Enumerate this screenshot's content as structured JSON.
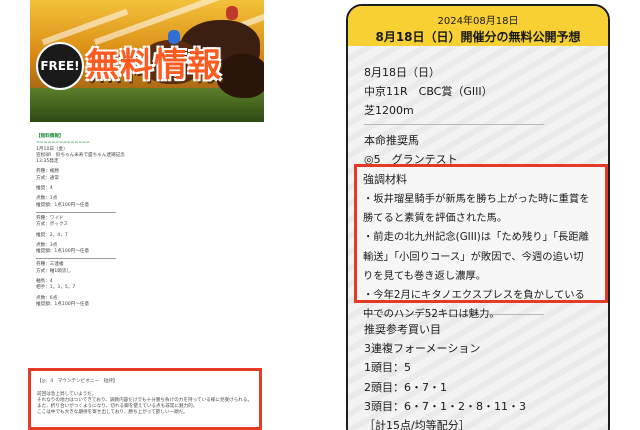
{
  "left_panel": {
    "banner": {
      "free_badge": "FREE!",
      "title": "無料情報"
    },
    "doc_lines": [
      {
        "text": "【無料情報】",
        "style": "head"
      },
      {
        "text": "==============",
        "style": "sep"
      },
      {
        "text": "1月10日（金）",
        "style": ""
      },
      {
        "text": "笠松8R　鈴ちゃん米寿で盛ちゃん逮捕記念",
        "style": ""
      },
      {
        "text": "13:35発走",
        "style": ""
      },
      {
        "text": "",
        "style": "gap"
      },
      {
        "text": "券種：複勝",
        "style": ""
      },
      {
        "text": "方式：通常",
        "style": ""
      },
      {
        "text": "",
        "style": "gap"
      },
      {
        "text": "推奨：4",
        "style": ""
      },
      {
        "text": "",
        "style": "gap"
      },
      {
        "text": "点数：1点",
        "style": ""
      },
      {
        "text": "推奨額：1点100円～任意",
        "style": ""
      },
      {
        "text": "",
        "style": "hr"
      },
      {
        "text": "券種：ワイド",
        "style": ""
      },
      {
        "text": "方式：ボックス",
        "style": ""
      },
      {
        "text": "",
        "style": "gap"
      },
      {
        "text": "推奨：2，4，7",
        "style": ""
      },
      {
        "text": "",
        "style": "gap"
      },
      {
        "text": "点数：3点",
        "style": ""
      },
      {
        "text": "推奨額：1点100円～任意",
        "style": ""
      },
      {
        "text": "",
        "style": "hr"
      },
      {
        "text": "券種：三連複",
        "style": ""
      },
      {
        "text": "方式：軸1頭流し",
        "style": ""
      },
      {
        "text": "",
        "style": "gap"
      },
      {
        "text": "軸馬：4",
        "style": ""
      },
      {
        "text": "相手：1，3，5，7",
        "style": ""
      },
      {
        "text": "",
        "style": "gap"
      },
      {
        "text": "点数：6点",
        "style": ""
      },
      {
        "text": "推奨額：1点100円～任意",
        "style": ""
      }
    ],
    "highlight_lines": [
      "【◎：4　マウンテンビオニー　短評】",
      "",
      "前回は急上昇していようだ。",
      "それなりの地力はついてきており、調教内容だけでも十分勝ち負けの力を持っている様に見受けられる。",
      "また、折り合いがつくようになり、切れる脚を使えている点も非常に魅力的。",
      "ここは中でも大きな期待を寄せ出しており、勝ち上がって欲しい一頭だ。"
    ]
  },
  "right_panel": {
    "header": {
      "date": "2024年08月18日",
      "title": "8月18日（日）開催分の無料公開予想"
    },
    "race_info": [
      "8月18日（日）",
      "中京11R　CBC賞（GIII）",
      "芝1200m"
    ],
    "honmei_label": "本命推奨馬",
    "honmei_value": "◎5　グランテスト",
    "highlight": {
      "title": "強調材料",
      "lines": [
        "・坂井瑠星騎手が新馬を勝ち上がった時に重賞を",
        "勝てると素質を評価された馬。",
        "・前走の北九州記念(GIII)は「ため残り」「長距離",
        "輸送」「小回りコース」が敗因で、今週の追い切",
        "りを見ても巻き返し濃厚。",
        "・今年2月にキタノエクスプレスを負かしている",
        "中でのハンデ52キロは魅力。"
      ]
    },
    "bet_label": "推奨参考買い目",
    "bet_type": "3連複フォーメーション",
    "bets": [
      "1頭目：5",
      "2頭目：6・7・1",
      "3頭目：6・7・1・2・8・11・3"
    ],
    "bet_total": "［計15点/均等配分］"
  },
  "colors": {
    "highlight_border": "#e53a28",
    "header_yellow": "#f7d034",
    "banner_title": "#ff5a1f",
    "doc_heading_green": "#1a8a3a"
  }
}
